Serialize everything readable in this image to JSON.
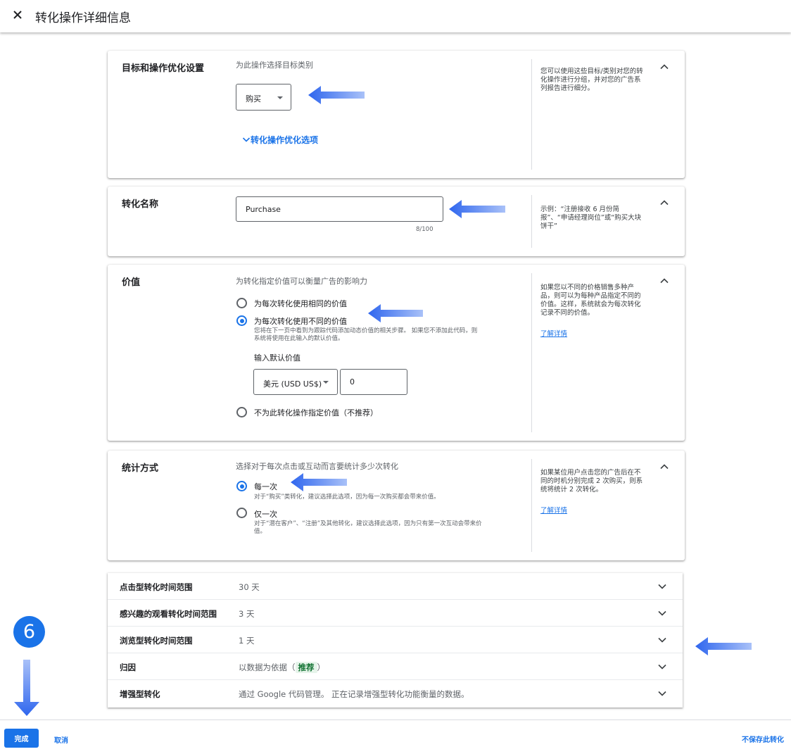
{
  "header": {
    "title": "转化操作详细信息",
    "close_icon": "close-icon"
  },
  "goal": {
    "label": "目标和操作优化设置",
    "description": "为此操作选择目标类别",
    "category_value": "购买",
    "optimization_link": "转化操作优化选项",
    "help": "您可以使用这些目标/类别对您的转化操作进行分组，并对您的广告系列报告进行细分。"
  },
  "name": {
    "label": "转化名称",
    "value": "Purchase",
    "counter": "8/100",
    "help": "示例：“注册接收 6 月份简报”、“申请经理岗位”或“购买大块饼干”"
  },
  "value": {
    "label": "价值",
    "description": "为转化指定价值可以衡量广告的影响力",
    "options": [
      {
        "label": "为每次转化使用相同的价值",
        "selected": false
      },
      {
        "label": "为每次转化使用不同的价值",
        "selected": true
      },
      {
        "label": "不为此转化操作指定价值（不推荐）",
        "selected": false
      }
    ],
    "different_hint_1": "您将在下一页中看到为跟踪代码添加动态价值的相关步骤。 如果您不添加此代码，则",
    "different_hint_2": "系统将使用在此输入的默认价值。",
    "default_label": "输入默认价值",
    "currency": "美元 (USD US$)",
    "amount": "0",
    "help": "如果您以不同的价格销售多种产品，则可以为每种产品指定不同的价值。这样，系统就会为每次转化记录不同的价值。",
    "help_link": "了解详情"
  },
  "count": {
    "label": "统计方式",
    "description": "选择对于每次点击或互动而言要统计多少次转化",
    "options": [
      {
        "label": "每一次",
        "hint": "对于“购买”类转化，建议选择此选项，因为每一次购买都会带来价值。",
        "selected": true
      },
      {
        "label": "仅一次",
        "hint_1": "对于“潜在客户”、“注册”及其他转化，建议选择此选项，因为只有第一次互动会带来价",
        "hint_2": "值。",
        "selected": false
      }
    ],
    "help": "如果某位用户点击您的广告后在不同的时机分别完成 2 次购买，则系统将统计 2 次转化。",
    "help_link": "了解详情"
  },
  "collapsed_rows": [
    {
      "key": "点击型转化时间范围",
      "value": "30 天"
    },
    {
      "key": "感兴趣的观看转化时间范围",
      "value": "3 天"
    },
    {
      "key": "浏览型转化时间范围",
      "value": "1 天"
    },
    {
      "key": "归因",
      "value": "以数据为依据（",
      "badge": "推荐",
      "value_end": "）"
    },
    {
      "key": "增强型转化",
      "value": "通过 Google 代码管理。 正在记录增强型转化功能衡量的数据。"
    }
  ],
  "footer": {
    "done": "完成",
    "cancel": "取消",
    "no_save": "不保存此转化"
  },
  "annotation": {
    "step_number": "6"
  },
  "colors": {
    "accent": "#1a73e8",
    "arrow": "#4a7cf0",
    "badge_bg": "#e6f4ea",
    "badge_text": "#137333"
  }
}
